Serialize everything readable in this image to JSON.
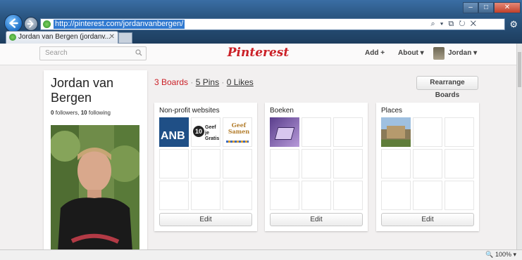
{
  "browser": {
    "url": "http://pinterest.com/jordanvanbergen/",
    "address_controls": "⌕ ▾ ⧉ ↻ ✕",
    "tab_title": "Jordan van Bergen (jordanv...",
    "tab_close": "✕",
    "window_buttons": {
      "minimize": "–",
      "maximize": "□",
      "close": "✕"
    },
    "toolbar_icons": [
      "home-icon",
      "star-icon",
      "gear-icon"
    ]
  },
  "header": {
    "search_placeholder": "Search",
    "logo": "Pinterest",
    "nav": {
      "add": "Add +",
      "about": "About ▾",
      "user": "Jordan ▾"
    }
  },
  "profile": {
    "name": "Jordan van Bergen",
    "followers_count": "0",
    "followers_label": "followers,",
    "following_count": "10",
    "following_label": "following"
  },
  "stats": {
    "boards": "3 Boards",
    "sep1": "·",
    "pins": "5 Pins",
    "sep2": "·",
    "likes": "0 Likes"
  },
  "rearrange_label": "Rearrange Boards",
  "boards": [
    {
      "title": "Non-profit websites",
      "edit_label": "Edit",
      "thumb_texts": [
        "ANB",
        "10",
        "Geef je Gratis",
        "Geef Samen"
      ]
    },
    {
      "title": "Boeken",
      "edit_label": "Edit"
    },
    {
      "title": "Places",
      "edit_label": "Edit"
    }
  ],
  "status": {
    "zoom": "🔍 100%  ▾"
  },
  "colors": {
    "brand": "#cb2027",
    "chrome": "#2a5580"
  }
}
